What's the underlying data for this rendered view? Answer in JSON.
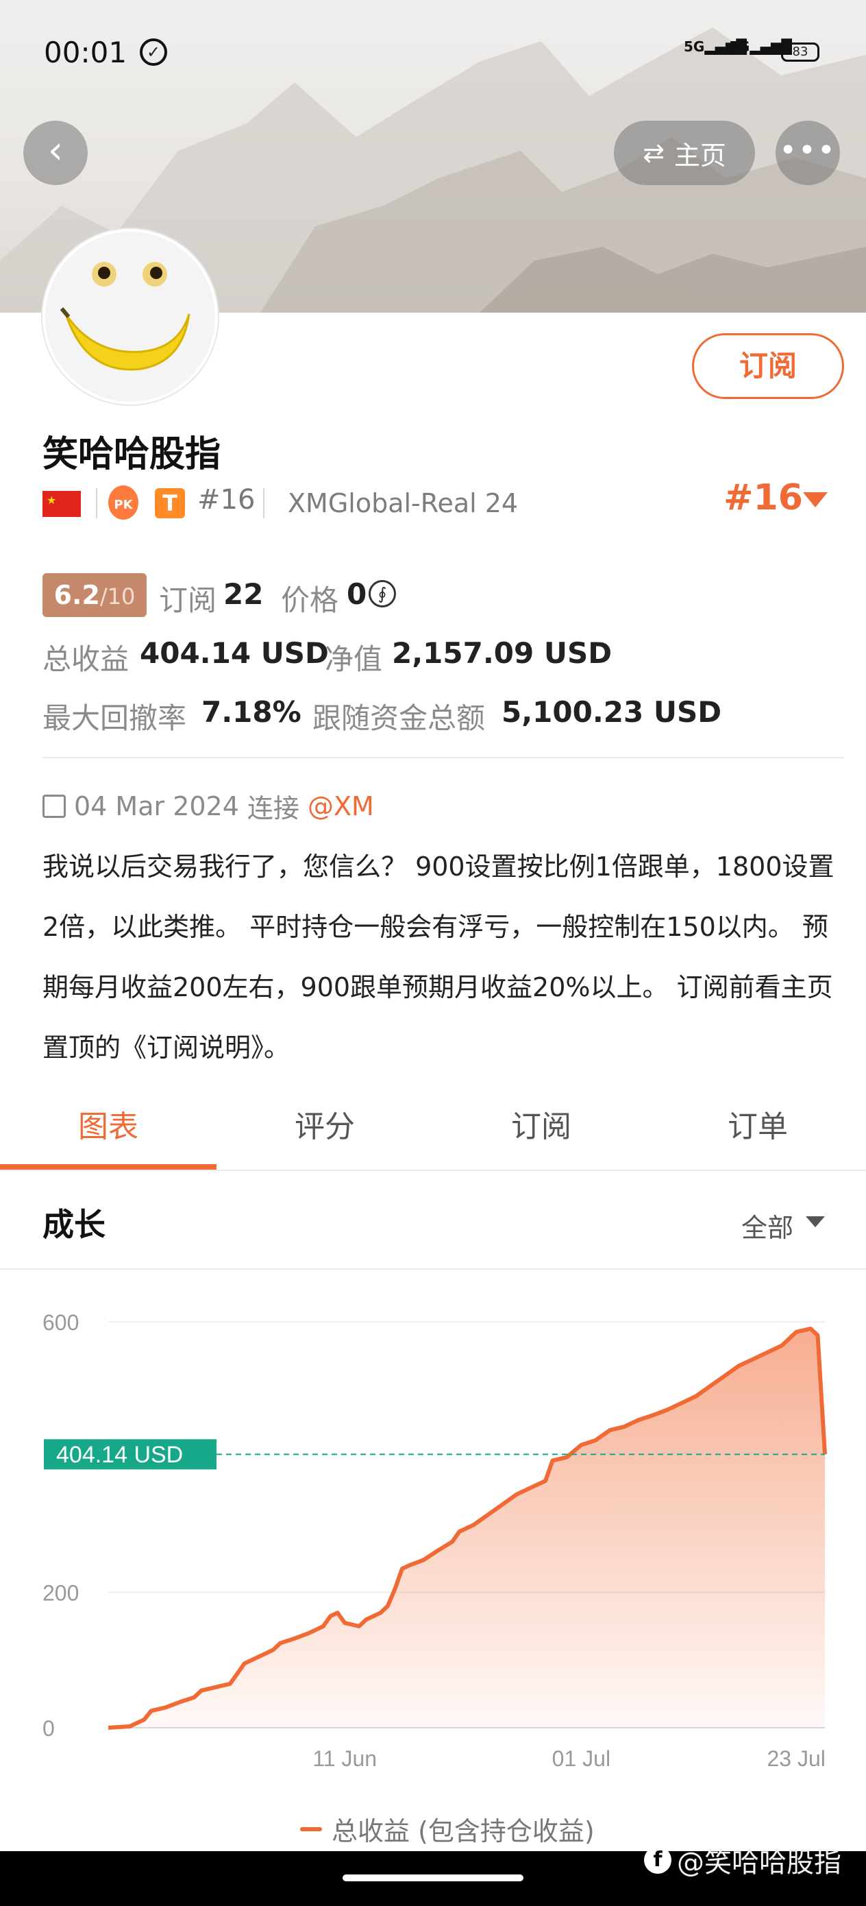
{
  "status": {
    "time": "00:01",
    "signal1": "5G",
    "signal2": "5G",
    "battery": "83"
  },
  "nav": {
    "home_label": "主页"
  },
  "profile": {
    "name": "笑哈哈股指",
    "subscribe_label": "订阅",
    "rank_small": "#16",
    "broker": "XMGlobal-Real 24",
    "rank_big": "#16",
    "t_badge": "T",
    "pk_badge": "PK"
  },
  "stats": {
    "score_value": "6.2",
    "score_max": "/10",
    "subscribe_label": "订阅",
    "subscribe_count": "22",
    "price_label": "价格",
    "price_value": "0",
    "total_profit_label": "总收益",
    "total_profit_value": "404.14 USD",
    "net_value_label": "净值",
    "net_value_value": "2,157.09 USD",
    "max_drawdown_label": "最大回撤率",
    "max_drawdown_value": "7.18%",
    "follow_funds_label": "跟随资金总额",
    "follow_funds_value": "5,100.23 USD"
  },
  "connect": {
    "date": "04 Mar 2024",
    "connect_label": "连接",
    "handle": "@XM"
  },
  "description": "我说以后交易我行了，您信么？ 900设置按比例1倍跟单，1800设置2倍，以此类推。 平时持仓一般会有浮亏，一般控制在150以内。 预期每月收益200左右，900跟单预期月收益20%以上。 订阅前看主页置顶的《订阅说明》。",
  "tabs": [
    {
      "label": "图表",
      "active": true
    },
    {
      "label": "评分",
      "active": false
    },
    {
      "label": "订阅",
      "active": false
    },
    {
      "label": "订单",
      "active": false
    }
  ],
  "section": {
    "title": "成长",
    "filter": "全部"
  },
  "colors": {
    "accent": "#f06a35",
    "current_line": "#17a88a"
  },
  "chart_data": {
    "type": "area",
    "title": "",
    "xlabel": "",
    "ylabel": "",
    "ylim": [
      0,
      600
    ],
    "y_ticks": [
      0,
      200,
      600
    ],
    "x_tick_labels": [
      {
        "label": "11 Jun",
        "x": 33
      },
      {
        "label": "01 Jul",
        "x": 66
      },
      {
        "label": "23 Jul",
        "x": 96
      }
    ],
    "grid": true,
    "legend_position": "bottom",
    "current_value": 404.14,
    "current_label": "404.14 USD",
    "series": [
      {
        "name": "总收益 (包含持仓收益)",
        "points": [
          [
            0,
            0
          ],
          [
            3,
            2
          ],
          [
            5,
            12
          ],
          [
            6,
            25
          ],
          [
            8,
            30
          ],
          [
            10,
            38
          ],
          [
            12,
            45
          ],
          [
            13,
            55
          ],
          [
            15,
            60
          ],
          [
            17,
            65
          ],
          [
            18,
            80
          ],
          [
            19,
            95
          ],
          [
            21,
            105
          ],
          [
            23,
            115
          ],
          [
            24,
            125
          ],
          [
            26,
            132
          ],
          [
            28,
            140
          ],
          [
            30,
            150
          ],
          [
            31,
            165
          ],
          [
            32,
            170
          ],
          [
            33,
            155
          ],
          [
            35,
            150
          ],
          [
            36,
            160
          ],
          [
            38,
            170
          ],
          [
            39,
            180
          ],
          [
            40,
            205
          ],
          [
            41,
            235
          ],
          [
            42,
            240
          ],
          [
            44,
            248
          ],
          [
            46,
            262
          ],
          [
            48,
            275
          ],
          [
            49,
            290
          ],
          [
            51,
            300
          ],
          [
            53,
            315
          ],
          [
            55,
            330
          ],
          [
            57,
            345
          ],
          [
            59,
            355
          ],
          [
            61,
            365
          ],
          [
            62,
            395
          ],
          [
            64,
            400
          ],
          [
            66,
            418
          ],
          [
            68,
            425
          ],
          [
            70,
            440
          ],
          [
            72,
            445
          ],
          [
            74,
            455
          ],
          [
            76,
            462
          ],
          [
            78,
            470
          ],
          [
            80,
            480
          ],
          [
            82,
            490
          ],
          [
            84,
            505
          ],
          [
            86,
            520
          ],
          [
            88,
            535
          ],
          [
            90,
            545
          ],
          [
            92,
            555
          ],
          [
            94,
            565
          ],
          [
            96,
            585
          ],
          [
            98,
            590
          ],
          [
            99,
            580
          ],
          [
            100,
            404.14
          ]
        ]
      }
    ]
  },
  "watermark": "@笑哈哈股指"
}
